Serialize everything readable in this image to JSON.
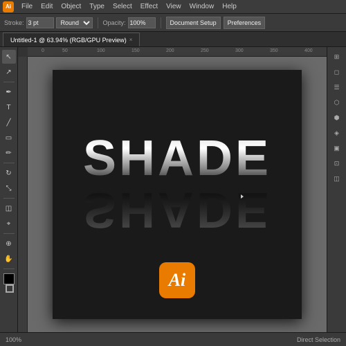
{
  "app": {
    "icon_label": "Ai",
    "title": "Adobe Illustrator"
  },
  "menubar": {
    "items": [
      "File",
      "Edit",
      "Object",
      "Type",
      "Select",
      "Effect",
      "View",
      "Window",
      "Help"
    ]
  },
  "toolbar": {
    "stroke_label": "Stroke:",
    "stroke_value": "3 pt",
    "stroke_type": "Round",
    "opacity_label": "Opacity:",
    "opacity_value": "100%",
    "document_setup": "Document Setup",
    "preferences": "Preferences"
  },
  "tab": {
    "title": "Untitled-1 @ 63.94% (RGB/GPU Preview)",
    "close_icon": "×"
  },
  "canvas": {
    "shade_text": "SHADE",
    "shade_reflected": "SHADE",
    "zoom": "63%"
  },
  "ai_logo": {
    "text": "Ai"
  },
  "tools": {
    "left": [
      "↖",
      "⬛",
      "✏",
      "🖊",
      "T",
      "🔗",
      "◻",
      "🌈",
      "🔲",
      "⚙",
      "👁",
      "⬡",
      "⬜",
      "✂",
      "🔍"
    ],
    "right": [
      "⚙",
      "◻",
      "☰",
      "⬡",
      "⬢",
      "◈",
      "⊞",
      "▣",
      "⊡",
      "◫"
    ]
  },
  "status": {
    "zoom": "100%",
    "mode": "Direct Selection",
    "extra": ""
  },
  "colors": {
    "background_dark": "#1a1a1a",
    "toolbar_bg": "#3a3a3a",
    "accent_orange": "#e87b00",
    "canvas_bg": "#606060",
    "text_light": "#ffffff",
    "text_muted": "#aaaaaa"
  }
}
